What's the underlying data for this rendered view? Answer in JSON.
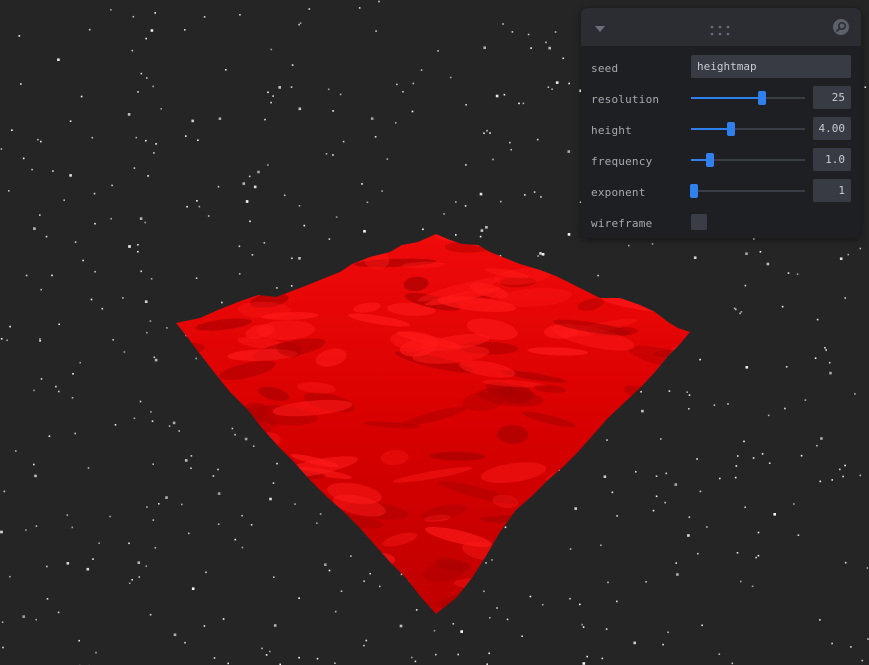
{
  "scene": {
    "background_color": "#252525",
    "star_color": "#ffffff",
    "terrain_color": "#e00000",
    "terrain_highlight": "#ff1a1a",
    "terrain_shadow": "#a80000"
  },
  "panel": {
    "header": {
      "collapse_icon": "chevron-down-icon",
      "drag_icon": "grip-dots-icon",
      "search_icon": "search-icon"
    },
    "accent_color": "#2f80ed",
    "seed": {
      "label": "seed",
      "value": "heightmap"
    },
    "resolution": {
      "label": "resolution",
      "value": "25",
      "fraction": 0.62
    },
    "height": {
      "label": "height",
      "value": "4.00",
      "fraction": 0.35
    },
    "frequency": {
      "label": "frequency",
      "value": "1.0",
      "fraction": 0.17
    },
    "exponent": {
      "label": "exponent",
      "value": "1",
      "fraction": 0.03
    },
    "wireframe": {
      "label": "wireframe",
      "checked": false
    }
  }
}
